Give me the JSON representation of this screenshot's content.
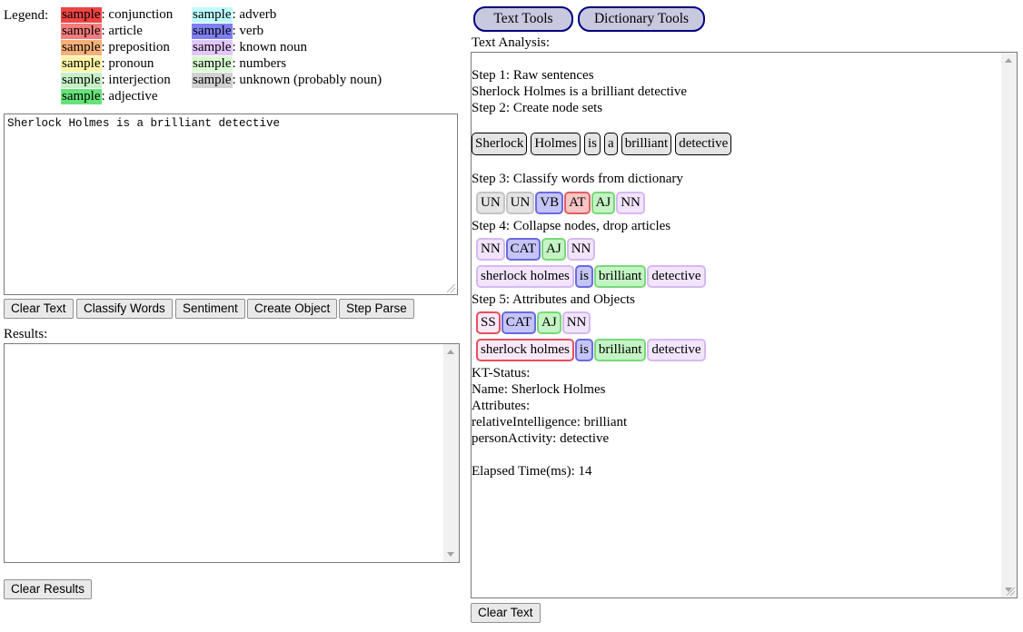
{
  "legend": {
    "label": "Legend:",
    "sample": "sample",
    "left": [
      {
        "name": "conjunction",
        "color": "#ee4444",
        "text": ": conjunction"
      },
      {
        "name": "article",
        "color": "#f47c7c",
        "text": ": article"
      },
      {
        "name": "preposition",
        "color": "#f5b078",
        "text": ": preposition"
      },
      {
        "name": "pronoun",
        "color": "#fdf3a6",
        "text": ": pronoun"
      },
      {
        "name": "interjection",
        "color": "#c7f0c7",
        "text": ": interjection"
      },
      {
        "name": "adjective",
        "color": "#66e27a",
        "text": ": adjective"
      }
    ],
    "right": [
      {
        "name": "adverb",
        "color": "#bffcfc",
        "text": ": adverb"
      },
      {
        "name": "verb",
        "color": "#7f7ff2",
        "text": ": verb"
      },
      {
        "name": "known-noun",
        "color": "#e2c6fa",
        "text": ": known noun"
      },
      {
        "name": "numbers",
        "color": "#d9fbd2",
        "text": ": numbers"
      },
      {
        "name": "unknown",
        "color": "#d2d2d2",
        "text": ": unknown (probably noun)"
      }
    ]
  },
  "input": {
    "value": "Sherlock Holmes is a brilliant detective"
  },
  "buttons": {
    "clear_text": "Clear Text",
    "classify_words": "Classify Words",
    "sentiment": "Sentiment",
    "create_object": "Create Object",
    "step_parse": "Step Parse",
    "clear_results": "Clear Results",
    "clear_text_right": "Clear Text"
  },
  "results": {
    "label": "Results:",
    "value": ""
  },
  "tools": {
    "text_tools": "Text Tools",
    "dictionary_tools": "Dictionary Tools"
  },
  "analysis": {
    "label": "Text Analysis:",
    "step1_title": "Step 1: Raw sentences",
    "raw_sentence": "Sherlock Holmes is a brilliant detective",
    "step2_title": "Step 2: Create node sets",
    "nodes": [
      "Sherlock",
      "Holmes",
      "is",
      "a",
      "brilliant",
      "detective"
    ],
    "step3_title": "Step 3: Classify words from dictionary",
    "step3_tags": [
      {
        "text": "UN",
        "kind": "unknown"
      },
      {
        "text": "UN",
        "kind": "unknown"
      },
      {
        "text": "VB",
        "kind": "verb"
      },
      {
        "text": "AT",
        "kind": "article"
      },
      {
        "text": "AJ",
        "kind": "adjective"
      },
      {
        "text": "NN",
        "kind": "noun"
      }
    ],
    "step4_title": "Step 4: Collapse nodes, drop articles",
    "step4_tags": [
      {
        "text": "NN",
        "kind": "noun"
      },
      {
        "text": "CAT",
        "kind": "verb"
      },
      {
        "text": "AJ",
        "kind": "adjective"
      },
      {
        "text": "NN",
        "kind": "noun"
      }
    ],
    "step4_words": [
      {
        "text": "sherlock holmes",
        "kind": "noun"
      },
      {
        "text": "is",
        "kind": "verb"
      },
      {
        "text": "brilliant",
        "kind": "adjective"
      },
      {
        "text": "detective",
        "kind": "noun"
      }
    ],
    "step5_title": "Step 5: Attributes and Objects",
    "step5_tags": [
      {
        "text": "SS",
        "kind": "subject"
      },
      {
        "text": "CAT",
        "kind": "verb"
      },
      {
        "text": "AJ",
        "kind": "adjective"
      },
      {
        "text": "NN",
        "kind": "noun"
      }
    ],
    "step5_words": [
      {
        "text": "sherlock holmes",
        "kind": "subject"
      },
      {
        "text": "is",
        "kind": "verb"
      },
      {
        "text": "brilliant",
        "kind": "adjective"
      },
      {
        "text": "detective",
        "kind": "noun"
      }
    ],
    "kt_status": "KT-Status:",
    "name_line": "Name: Sherlock Holmes",
    "attributes_label": "Attributes:",
    "attr1": "relativeIntelligence: brilliant",
    "attr2": "personActivity: detective",
    "elapsed": "Elapsed Time(ms): 14"
  },
  "chip_styles": {
    "unknown": {
      "bg": "#e4e4e4",
      "border": "#c4c4c4"
    },
    "verb": {
      "bg": "#c4c4f8",
      "border": "#6a6ae0"
    },
    "article": {
      "bg": "#f8c4c4",
      "border": "#e06060"
    },
    "adjective": {
      "bg": "#c4f4c4",
      "border": "#78d878"
    },
    "noun": {
      "bg": "#f1e4fc",
      "border": "#d6b8f0"
    },
    "subject": {
      "bg": "#f8e8f8",
      "border": "#e8505a"
    }
  }
}
